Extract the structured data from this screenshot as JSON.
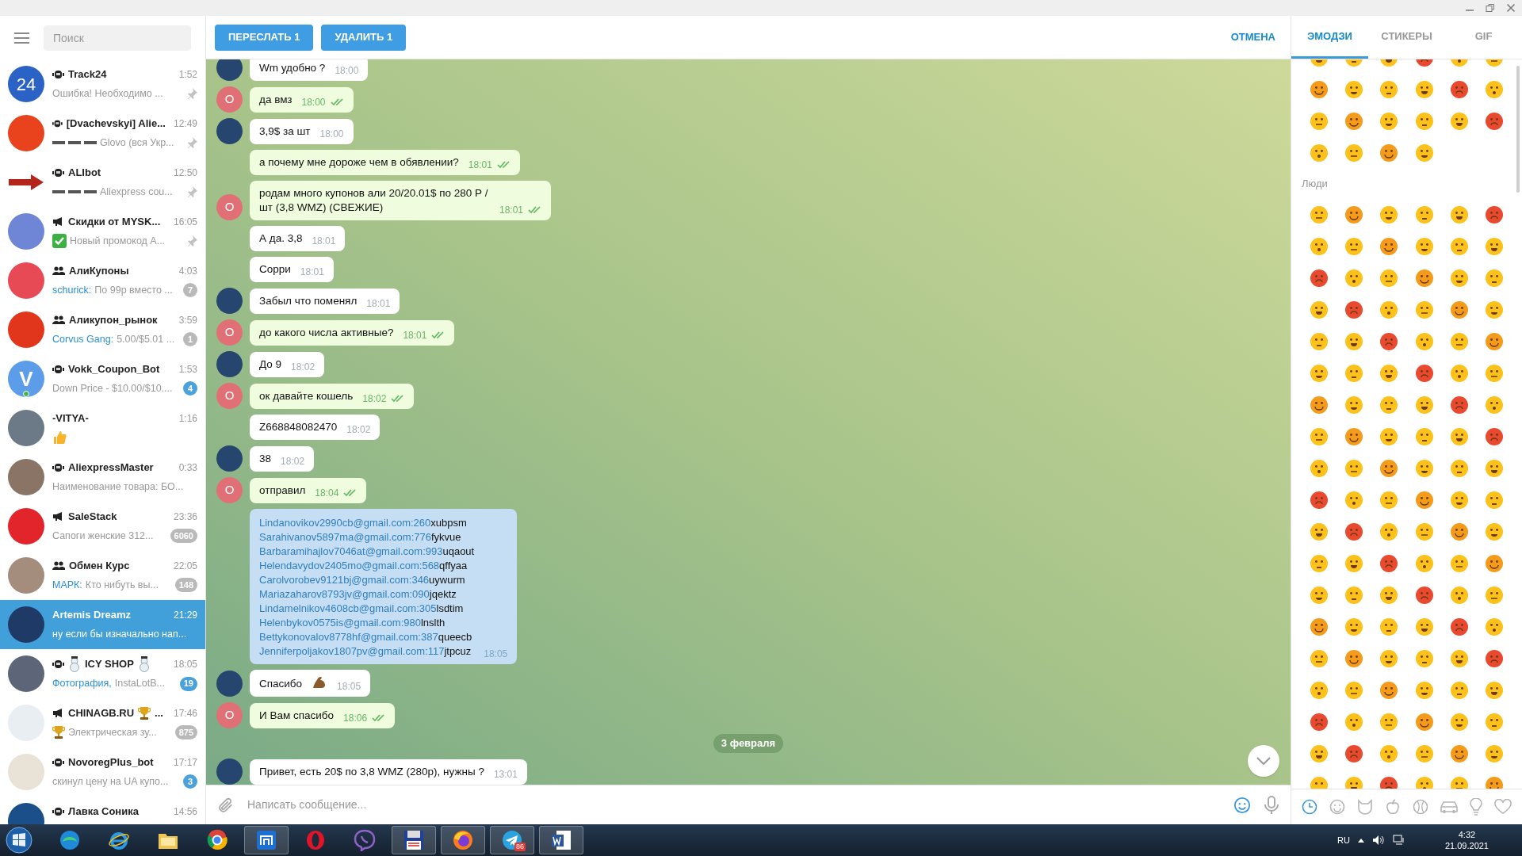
{
  "search": {
    "placeholder": "Поиск"
  },
  "chats": [
    {
      "name": "Track24",
      "kind": "bot",
      "time": "1:52",
      "preview": "Ошибка! Необходимо ...",
      "pinned": true,
      "selected": false,
      "avatar": {
        "color": "#2a62c6",
        "text": "24"
      }
    },
    {
      "name": "[Dvachevskyi] Alie...",
      "kind": "bot",
      "time": "12:49",
      "prefix": {
        "kind": "dashes"
      },
      "preview": "Glovo (вся Укр...",
      "pinned": true,
      "selected": false,
      "avatar": {
        "color": "#e8431d"
      }
    },
    {
      "name": "ALIbot",
      "kind": "bot",
      "time": "12:50",
      "prefix": {
        "kind": "dashes"
      },
      "preview": "Aliexpress cou...",
      "pinned": true,
      "selected": false,
      "avatar": {
        "color": "#ffffff",
        "kind": "arrow"
      }
    },
    {
      "name": "Скидки от MYSK...",
      "kind": "channel",
      "time": "16:05",
      "prefix": {
        "kind": "check"
      },
      "preview": "Новый промокод А...",
      "pinned": true,
      "selected": false,
      "avatar": {
        "color": "#6f85d6"
      }
    },
    {
      "name": "АлиКупоны",
      "kind": "group",
      "time": "4:03",
      "sender": "schurick:",
      "preview": "По 99р вместо ...",
      "selected": false,
      "badge": {
        "count": "7",
        "muted": true
      },
      "avatar": {
        "color": "#e84a55"
      }
    },
    {
      "name": "Аликупон_рынок",
      "kind": "group",
      "time": "3:59",
      "sender": "Corvus Gang:",
      "preview": "5.00/$5.01 ...",
      "selected": false,
      "badge": {
        "count": "1",
        "muted": true
      },
      "avatar": {
        "color": "#e2361c"
      }
    },
    {
      "name": "Vokk_Coupon_Bot",
      "kind": "bot",
      "time": "1:53",
      "preview": "Down Price - $10.00/$10....",
      "selected": false,
      "badge": {
        "count": "4",
        "muted": false
      },
      "online": true,
      "avatar": {
        "color": "#5b9de8",
        "text": "V"
      }
    },
    {
      "name": "-VITYA-",
      "kind": "person",
      "time": "1:16",
      "prefix": {
        "kind": "thumbs"
      },
      "selected": false,
      "avatar": {
        "color": "#6b7a86"
      }
    },
    {
      "name": "AliexpressMaster",
      "kind": "bot",
      "time": "0:33",
      "preview": "Наименование товара: БО...",
      "selected": false,
      "avatar": {
        "color": "#8a7466"
      }
    },
    {
      "name": "SaleStack",
      "kind": "channel",
      "time": "23:36",
      "preview": "Сапоги женские 312...",
      "selected": false,
      "badge": {
        "count": "6060",
        "muted": true
      },
      "avatar": {
        "color": "#e2242b"
      }
    },
    {
      "name": "Обмен Курс",
      "kind": "group",
      "time": "22:05",
      "sender": "МАРК:",
      "preview": "Кто нибуть вы...",
      "selected": false,
      "badge": {
        "count": "148",
        "muted": true
      },
      "avatar": {
        "color": "#a58d7d"
      }
    },
    {
      "name": "Artemis Dreamz",
      "kind": "person",
      "time": "21:29",
      "preview": "ну если бы изначально нап...",
      "selected": true,
      "avatar": {
        "color": "#1f3a66"
      }
    },
    {
      "name": "ICY SHOP",
      "kind": "bot",
      "name_icon": {
        "kind": "snowman"
      },
      "time": "18:05",
      "sender": "Фотография,",
      "preview": "InstaLotB...",
      "selected": false,
      "badge": {
        "count": "19",
        "muted": false
      },
      "avatar": {
        "color": "#5d6678"
      }
    },
    {
      "name": "CHINAGB.RU",
      "kind": "channel",
      "name_icon": {
        "kind": "trophy"
      },
      "name_tail": "...",
      "time": "17:46",
      "prefix": {
        "kind": "trophy"
      },
      "preview": "Электрическая зу...",
      "selected": false,
      "badge": {
        "count": "875",
        "muted": true
      },
      "avatar": {
        "color": "#e9eef2"
      }
    },
    {
      "name": "NovoregPlus_bot",
      "kind": "bot",
      "time": "17:17",
      "preview": "скинул цену на UA купо...",
      "selected": false,
      "badge": {
        "count": "3",
        "muted": false
      },
      "avatar": {
        "color": "#e9e2d6"
      }
    },
    {
      "name": "Лавка Соника",
      "kind": "bot",
      "time": "14:56",
      "selected": false,
      "avatar": {
        "color": "#1b4f8a"
      }
    }
  ],
  "header": {
    "forward": "ПЕРЕСЛАТЬ 1",
    "delete": "УДАЛИТЬ 1",
    "cancel": "ОТМЕНА"
  },
  "messages": [
    {
      "outgoing": false,
      "avatar": true,
      "text": "Wm удобно ?",
      "time": "18:00",
      "selected": false
    },
    {
      "outgoing": true,
      "avatar": true,
      "avatar_letter": "О",
      "text": "да вмз",
      "time": "18:00",
      "read": true,
      "selected": false
    },
    {
      "outgoing": false,
      "avatar": true,
      "text": "3,9$ за шт",
      "time": "18:00",
      "selected": false
    },
    {
      "outgoing": true,
      "avatar": false,
      "text": "а почему мне дороже чем в обявлении?",
      "time": "18:01",
      "read": true,
      "selected": false
    },
    {
      "outgoing": true,
      "avatar": true,
      "avatar_letter": "О",
      "text": "родам много купонов али 20/20.01$ по 280 Р /шт (3,8 WMZ) (СВЕЖИЕ)",
      "time": "18:01",
      "read": true,
      "selected": false
    },
    {
      "outgoing": false,
      "avatar": false,
      "text": "А да. 3,8",
      "time": "18:01",
      "selected": false
    },
    {
      "outgoing": false,
      "avatar": false,
      "text": "Сорри",
      "time": "18:01",
      "selected": false
    },
    {
      "outgoing": false,
      "avatar": true,
      "text": "Забыл что поменял",
      "time": "18:01",
      "selected": false
    },
    {
      "outgoing": true,
      "avatar": true,
      "avatar_letter": "О",
      "text": "до какого числа активные?",
      "time": "18:01",
      "read": true,
      "selected": false
    },
    {
      "outgoing": false,
      "avatar": true,
      "text": "До 9",
      "time": "18:02",
      "selected": false
    },
    {
      "outgoing": true,
      "avatar": true,
      "avatar_letter": "О",
      "text": "ок давайте кошель",
      "time": "18:02",
      "read": true,
      "selected": false
    },
    {
      "outgoing": false,
      "avatar": false,
      "text": "Z668848082470",
      "time": "18:02",
      "selected": false
    },
    {
      "outgoing": false,
      "avatar": true,
      "text": "38",
      "time": "18:02",
      "selected": false
    },
    {
      "outgoing": true,
      "avatar": true,
      "avatar_letter": "О",
      "text": "отправил",
      "time": "18:04",
      "read": true,
      "selected": false
    },
    {
      "outgoing": false,
      "avatar": false,
      "kind": "list",
      "time": "18:05",
      "selected": true,
      "lines": [
        {
          "link": "Lindanovikov2990cb@gmail.com:260",
          "text": "xubpsm"
        },
        {
          "link": "Sarahivanov5897ma@gmail.com:776",
          "text": "fykvue"
        },
        {
          "link": "Barbaramihajlov7046at@gmail.com:993",
          "text": "uqaout"
        },
        {
          "link": "Helendavydov2405mo@gmail.com:568",
          "text": "qffyaa"
        },
        {
          "link": "Carolvorobev9121bj@gmail.com:346",
          "text": "uywurm"
        },
        {
          "link": "Mariazaharov8793jv@gmail.com:090",
          "text": "jqektz"
        },
        {
          "link": "Lindamelnikov4608cb@gmail.com:305",
          "text": "lsdtim"
        },
        {
          "link": "Helenbykov0575is@gmail.com:980",
          "text": "lnslth"
        },
        {
          "link": "Bettykonovalov8778hf@gmail.com:387",
          "text": "queecb"
        },
        {
          "link": "Jenniferpoljakov1807pv@gmail.com:117",
          "text": "jtpcuz"
        }
      ]
    },
    {
      "outgoing": false,
      "avatar": true,
      "text": "Спасибо",
      "emoji": {
        "kind": "flex"
      },
      "time": "18:05",
      "selected": false
    },
    {
      "outgoing": true,
      "avatar": true,
      "avatar_letter": "О",
      "text": "И Вам спасибо",
      "time": "18:06",
      "read": true,
      "selected": false
    },
    {
      "kind": "date",
      "text": "3 февраля"
    },
    {
      "outgoing": false,
      "avatar": true,
      "text": "Привет, есть 20$ по 3,8 WMZ (280р), нужны ?",
      "time": "13:01",
      "selected": false
    }
  ],
  "composer": {
    "placeholder": "Написать сообщение..."
  },
  "emoji_panel": {
    "tabs": [
      {
        "label": "ЭМОДЗИ",
        "selected": true
      },
      {
        "label": "СТИКЕРЫ",
        "selected": false
      },
      {
        "label": "GIF",
        "selected": false
      }
    ],
    "section": "Люди",
    "categories": [
      {
        "kind": "recent",
        "selected": true
      },
      {
        "kind": "people",
        "selected": false
      },
      {
        "kind": "animals",
        "selected": false
      },
      {
        "kind": "food",
        "selected": false
      },
      {
        "kind": "activity",
        "selected": false
      },
      {
        "kind": "travel",
        "selected": false
      },
      {
        "kind": "objects",
        "selected": false
      },
      {
        "kind": "symbols",
        "selected": false
      }
    ]
  },
  "taskbar": {
    "apps": [
      {
        "kind": "wave",
        "running": false
      },
      {
        "kind": "e",
        "running": false
      },
      {
        "kind": "folder",
        "running": false
      },
      {
        "kind": "ball",
        "running": false
      },
      {
        "kind": "square",
        "running": true
      },
      {
        "kind": "ring",
        "running": false
      },
      {
        "kind": "phone",
        "running": false
      },
      {
        "kind": "floppy",
        "running": true
      },
      {
        "kind": "fox",
        "running": true
      },
      {
        "kind": "plane",
        "running": true,
        "badge": "86"
      },
      {
        "kind": "doc",
        "running": true
      }
    ],
    "language": "RU",
    "time": "4:32",
    "date": "21.09.2021"
  }
}
